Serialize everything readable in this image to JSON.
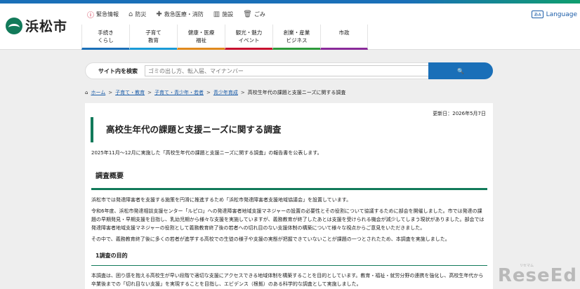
{
  "header": {
    "logo_text": "浜松市",
    "util": [
      {
        "icon": "alert-icon",
        "glyph": "ⓘ",
        "label": "緊急情報"
      },
      {
        "icon": "house-icon",
        "glyph": "⌂",
        "label": "防災"
      },
      {
        "icon": "medical-icon",
        "glyph": "✚",
        "label": "救急医療・消防"
      },
      {
        "icon": "building-icon",
        "glyph": "▥",
        "label": "施設"
      },
      {
        "icon": "trash-icon",
        "glyph": "🗑",
        "label": "ごみ"
      }
    ],
    "language_icon": "あA",
    "language_label": "Language"
  },
  "gnav": [
    {
      "line1": "手続き",
      "line2": "くらし",
      "color": "#1a6fb8"
    },
    {
      "line1": "子育て",
      "line2": "教育",
      "color": "#1a9bd7"
    },
    {
      "line1": "健康・医療",
      "line2": "福祉",
      "color": "#e08a1e"
    },
    {
      "line1": "観光・魅力",
      "line2": "イベント",
      "color": "#c8102e"
    },
    {
      "line1": "創業・産業",
      "line2": "ビジネス",
      "color": "#2e9a3c"
    },
    {
      "line1": "市政",
      "line2": "",
      "color": "#8a2a9a"
    }
  ],
  "search": {
    "label": "サイト内を検索",
    "placeholder": "ゴミの出し方、転入届、マイナンバー",
    "button_icon": "🔍"
  },
  "breadcrumb": [
    {
      "label": "ホーム",
      "link": true
    },
    {
      "label": "子育て・教育",
      "link": true
    },
    {
      "label": "子育て・青少年・若者",
      "link": true
    },
    {
      "label": "青少年育成",
      "link": true
    },
    {
      "label": "高校生年代の課題と支援ニーズに関する調査",
      "link": false
    }
  ],
  "main": {
    "updated": "更新日：2026年5月7日",
    "title": "高校生年代の課題と支援ニーズに関する調査",
    "intro": "2025年11月～12月に実施した「高校生年代の課題と支援ニーズに関する調査」の報告書を公表します。",
    "h2": "調査概要",
    "p1": "浜松市では発達障害者を支援する施策を円滑に推進するため「浜松市発達障害者支援地域協議会」を設置しています。",
    "p2": "令和6年度、浜松市発達相談支援センター「ルピロ」への発達障害者地域支援マネジャーの設置の必要性とその役割について協議するために部会を開催しました。市では発達の課題の早期発見・早期支援を目指し、乳幼児期から様々な支援を実施していますが、義務教育が終了したあとは支援を受けられる機会が減少してしまう現状がありました。部会では発達障害者地域支援マネジャーの役割として義務教育終了後の若者への切れ目のない支援体制の構築について様々な視点からご意見をいただきました。",
    "p3": "その中で、義務教育終了後に多くの若者が進学する高校での生徒の様子や支援の実態が把握できていないことが課題の一つとされたため、本調査を実施しました。",
    "h3": "1調査の目的",
    "p4": "本調査は、困り感を抱える高校生が早い段階で適切な支援にアクセスできる地域体制を構築することを目的としています。教育・福祉・就労分野の連携を強化し、高校生年代から卒業後までの「切れ目ない支援」を実現することを目指し、エビデンス（根拠）のある科学的な調査として実施しました。"
  },
  "watermark": {
    "sub": "リセマム",
    "main": "ReseEd"
  }
}
